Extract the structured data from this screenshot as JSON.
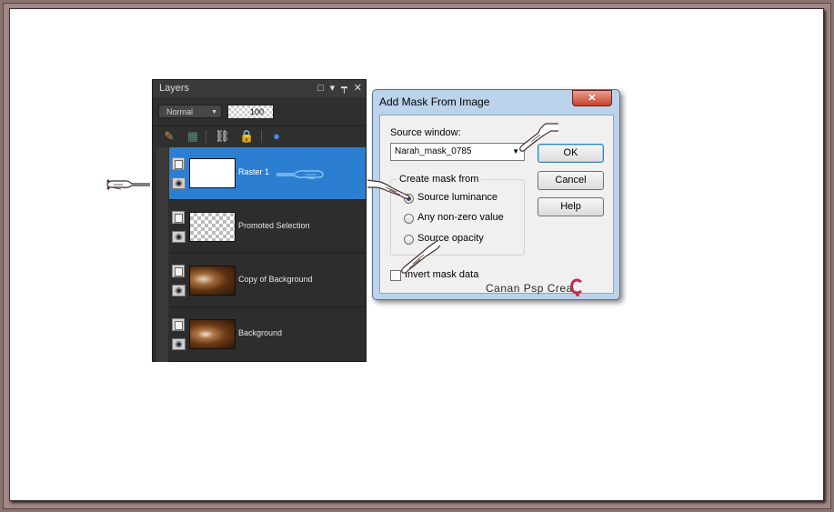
{
  "layers_panel": {
    "title": "Layers",
    "blend_mode": "Normal",
    "opacity": "100",
    "layers": [
      {
        "name": "Raster 1"
      },
      {
        "name": "Promoted Selection"
      },
      {
        "name": "Copy of Background"
      },
      {
        "name": "Background"
      }
    ]
  },
  "dialog": {
    "title": "Add Mask From Image",
    "close_glyph": "✕",
    "source_window_label": "Source window:",
    "source_window_value": "Narah_mask_0785",
    "group_label": "Create mask from",
    "options": [
      "Source luminance",
      "Any non-zero value",
      "Source opacity"
    ],
    "selected_option": "Source luminance",
    "invert_label": "Invert mask data",
    "invert_checked": false,
    "buttons": {
      "ok": "OK",
      "cancel": "Cancel",
      "help": "Help"
    }
  },
  "watermark": "Canan Psp Crea",
  "icons": [
    "hand-pointer-icon",
    "eye-icon",
    "link-icon",
    "lock-icon",
    "mask-icon",
    "brush-icon"
  ]
}
